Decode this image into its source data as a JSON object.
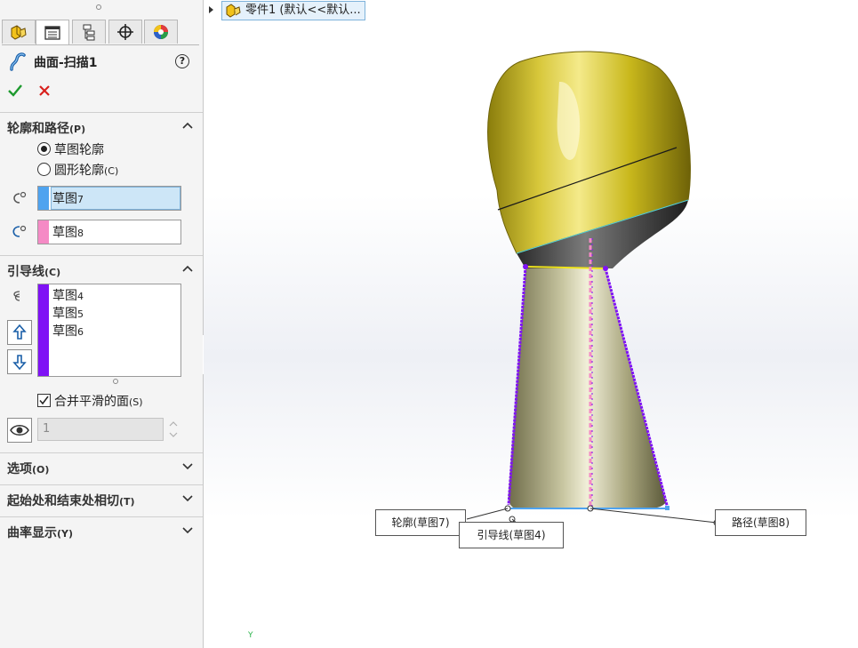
{
  "panel": {
    "feature_title": "曲面-扫描1",
    "help_label": "?",
    "icons": {
      "tabs": [
        "feature-manager-icon",
        "property-manager-icon",
        "configuration-manager-icon",
        "dimxpert-icon",
        "display-manager-icon"
      ],
      "ok": "checkmark-icon",
      "cancel": "close-icon"
    },
    "profile_path": {
      "title": "轮廓和路径",
      "hotkey": "(P)",
      "options": [
        {
          "label": "草图轮廓",
          "hotkey": "",
          "selected": true
        },
        {
          "label": "圆形轮廓",
          "hotkey": "(C)",
          "selected": false
        }
      ],
      "profile_selection": {
        "name": "草图",
        "num": "7",
        "color": "#4fa3ef"
      },
      "path_selection": {
        "name": "草图",
        "num": "8",
        "color": "#f58ac5"
      }
    },
    "guide_curves": {
      "title": "引导线",
      "hotkey": "(C)",
      "items": [
        {
          "name": "草图",
          "num": "4"
        },
        {
          "name": "草图",
          "num": "5"
        },
        {
          "name": "草图",
          "num": "6"
        }
      ],
      "color": "#7f12f5",
      "merge_label": "合并平滑的面",
      "merge_hotkey": "(S)",
      "merge_checked": true,
      "count_value": "1"
    },
    "options_section": {
      "title": "选项",
      "hotkey": "(O)"
    },
    "tangency_section": {
      "title": "起始处和结束处相切",
      "hotkey": "(T)"
    },
    "curvature_section": {
      "title": "曲率显示",
      "hotkey": "(Y)"
    }
  },
  "viewport": {
    "tree_node": "零件1 (默认<<默认...",
    "callouts": {
      "profile": "轮廓(草图7)",
      "guide": "引导线(草图4)",
      "path": "路径(草图8)"
    },
    "axis_label": "Y",
    "colors": {
      "cap": "#c9b81c",
      "body": "#b6b387",
      "guide": "#7f12f5",
      "path": "#f58ac5",
      "profile": "#4fa3ef"
    }
  }
}
